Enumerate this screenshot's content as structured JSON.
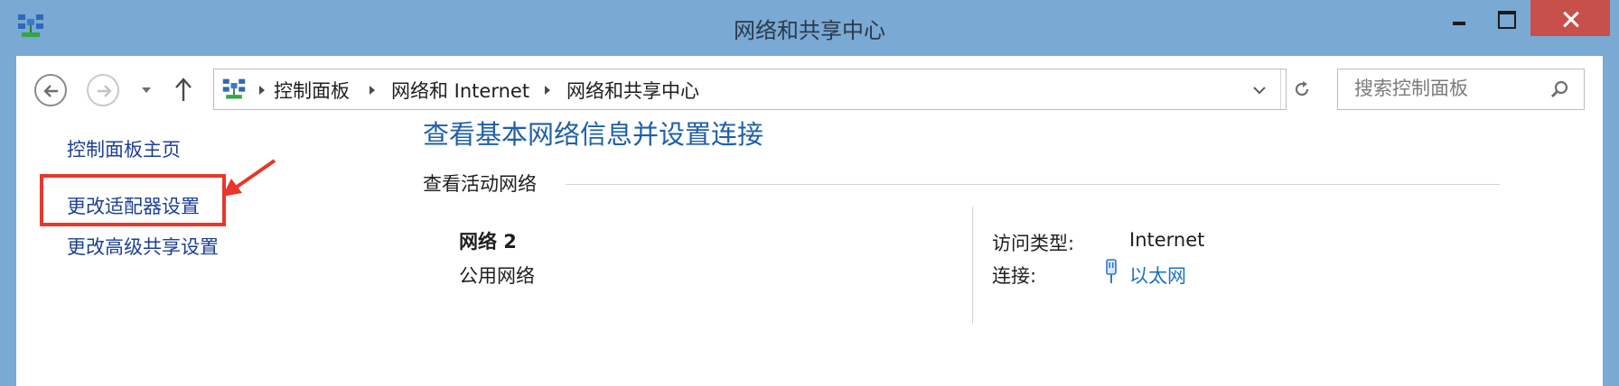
{
  "window": {
    "title": "网络和共享中心"
  },
  "navbar": {
    "breadcrumbs": [
      "控制面板",
      "网络和 Internet",
      "网络和共享中心"
    ],
    "search_placeholder": "搜索控制面板"
  },
  "sidebar": {
    "links": [
      "控制面板主页",
      "更改适配器设置",
      "更改高级共享设置"
    ]
  },
  "main": {
    "title": "查看基本网络信息并设置连接",
    "section_label": "查看活动网络",
    "network": {
      "name": "网络 2",
      "type": "公用网络",
      "access_type_label": "访问类型:",
      "access_type_value": "Internet",
      "connection_label": "连接:",
      "connection_value": "以太网"
    }
  },
  "colors": {
    "titlebar": "#7aa9d3",
    "close_button": "#c7504b",
    "link": "#1c3f94",
    "title_blue": "#1f5fa8",
    "highlight_red": "#e8372a"
  },
  "icons": [
    "network-center-icon",
    "back-arrow-icon",
    "forward-arrow-icon",
    "chevron-down-icon",
    "up-arrow-icon",
    "chevron-right-icon",
    "refresh-icon",
    "search-icon",
    "ethernet-icon",
    "red-arrow-annotation"
  ]
}
